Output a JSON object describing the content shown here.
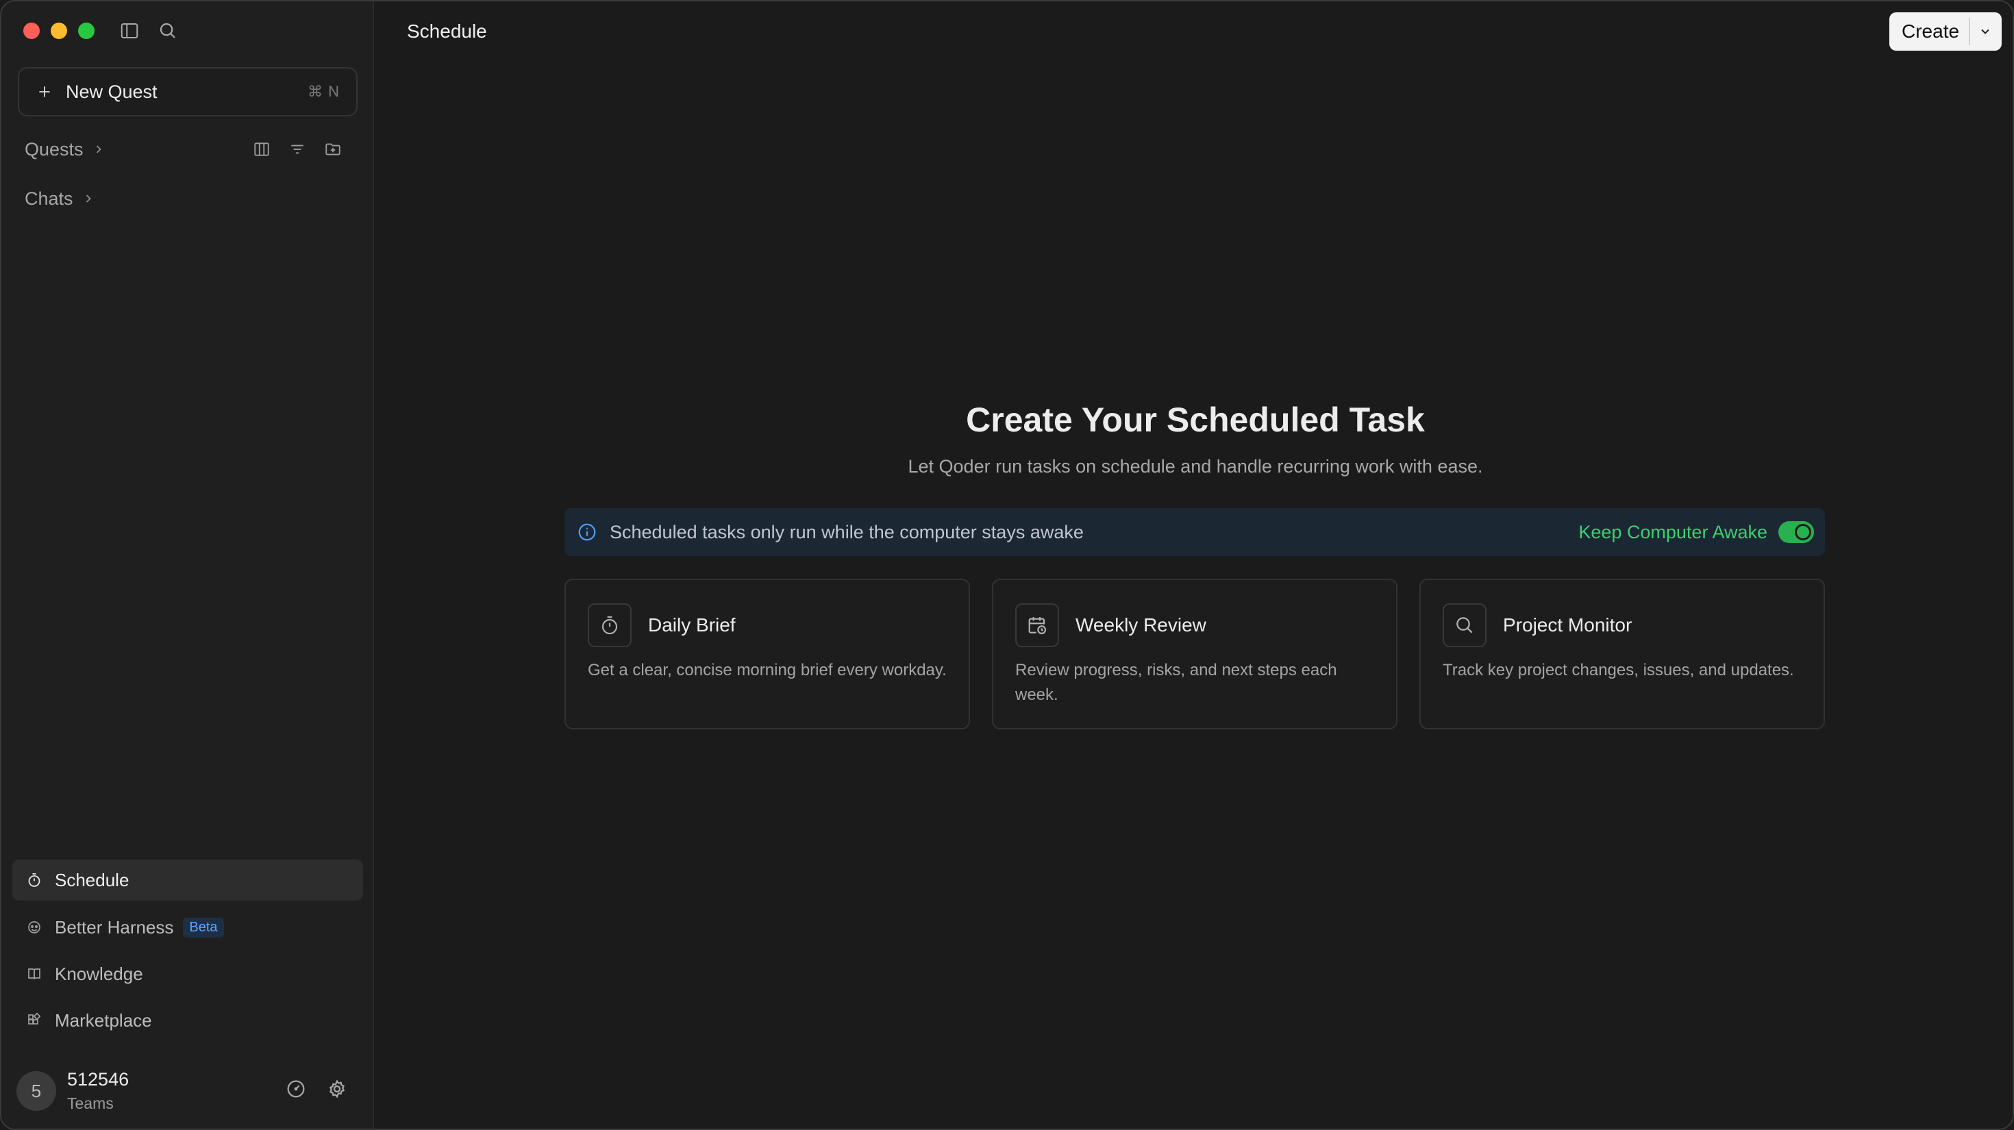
{
  "sidebar": {
    "new_quest": {
      "label": "New Quest",
      "shortcut": "⌘ N"
    },
    "sections": {
      "quests": "Quests",
      "chats": "Chats"
    },
    "nav": [
      {
        "label": "Schedule",
        "icon": "timer-icon",
        "active": true
      },
      {
        "label": "Better Harness",
        "icon": "harness-icon",
        "badge": "Beta"
      },
      {
        "label": "Knowledge",
        "icon": "book-icon"
      },
      {
        "label": "Marketplace",
        "icon": "marketplace-icon"
      }
    ],
    "user": {
      "avatar_letter": "5",
      "name": "512546",
      "plan": "Teams"
    }
  },
  "header": {
    "title": "Schedule",
    "create_label": "Create"
  },
  "hero": {
    "title": "Create Your Scheduled Task",
    "subtitle": "Let Qoder run tasks on schedule and handle recurring work with ease."
  },
  "awake": {
    "message": "Scheduled tasks only run while the computer stays awake",
    "toggle_label": "Keep Computer Awake",
    "enabled": true
  },
  "templates": [
    {
      "title": "Daily Brief",
      "description": "Get a clear, concise morning brief every workday.",
      "icon": "timer-icon"
    },
    {
      "title": "Weekly Review",
      "description": "Review progress, risks, and next steps each week.",
      "icon": "calendar-clock-icon"
    },
    {
      "title": "Project Monitor",
      "description": "Track key project changes, issues, and updates.",
      "icon": "search-icon"
    }
  ],
  "colors": {
    "accent_green": "#28b14f",
    "info_blue": "#4e9bff",
    "beta_blue": "#5aa7ff"
  }
}
